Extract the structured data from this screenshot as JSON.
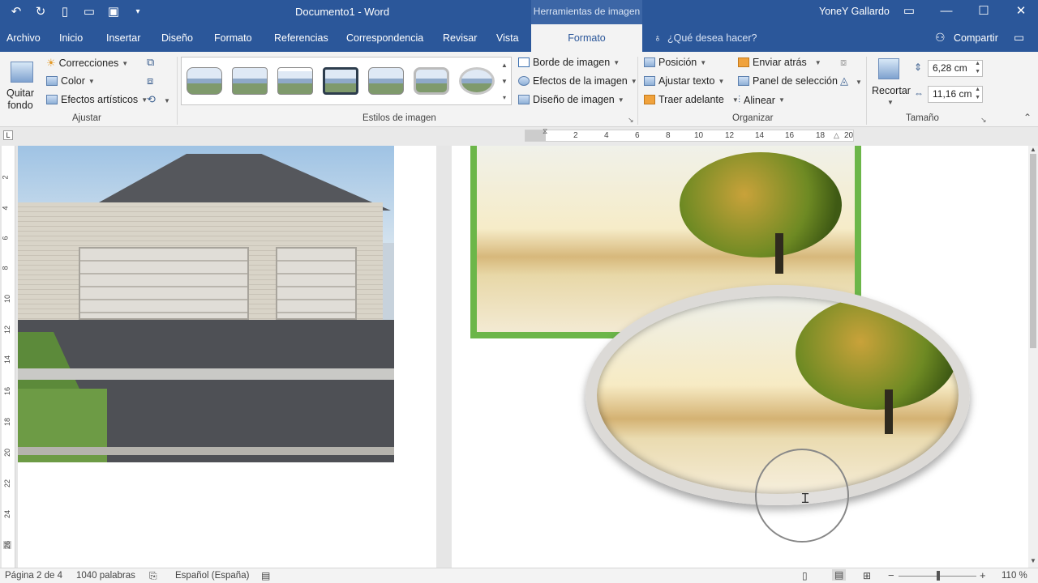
{
  "window": {
    "title": "Documento1 - Word",
    "context_tab_header": "Herramientas de imagen",
    "user": "YoneY Gallardo"
  },
  "tabs": [
    "Archivo",
    "Inicio",
    "Insertar",
    "Diseño",
    "Formato",
    "Referencias",
    "Correspondencia",
    "Revisar",
    "Vista"
  ],
  "active_tab": "Formato",
  "tell_me_placeholder": "¿Qué desea hacer?",
  "share_label": "Compartir",
  "ribbon": {
    "ajustar": {
      "quitar_fondo": [
        "Quitar",
        "fondo"
      ],
      "correcciones": "Correcciones",
      "color": "Color",
      "efectos_artisticos": "Efectos artísticos",
      "group_label": "Ajustar"
    },
    "estilos": {
      "borde": "Borde de imagen",
      "efectos": "Efectos de la imagen",
      "diseno": "Diseño de imagen",
      "group_label": "Estilos de imagen"
    },
    "organizar": {
      "posicion": "Posición",
      "ajustar_texto": "Ajustar texto",
      "traer_adelante": "Traer adelante",
      "enviar_atras": "Enviar atrás",
      "panel_seleccion": "Panel de selección",
      "alinear": "Alinear",
      "group_label": "Organizar"
    },
    "tamano": {
      "recortar": "Recortar",
      "height": "6,28 cm",
      "width": "11,16 cm",
      "group_label": "Tamaño"
    }
  },
  "hruler_numbers": [
    "2",
    "4",
    "6",
    "8",
    "10",
    "12",
    "14",
    "16",
    "18",
    "20"
  ],
  "vruler_numbers": [
    "2",
    "4",
    "6",
    "8",
    "10",
    "12",
    "14",
    "16",
    "18",
    "20",
    "22",
    "24",
    "26"
  ],
  "status": {
    "page": "Página 2 de 4",
    "words": "1040 palabras",
    "language": "Español (España)",
    "zoom": "110 %"
  },
  "colors": {
    "brand": "#2b579a",
    "picture_border": "#6cb649"
  }
}
